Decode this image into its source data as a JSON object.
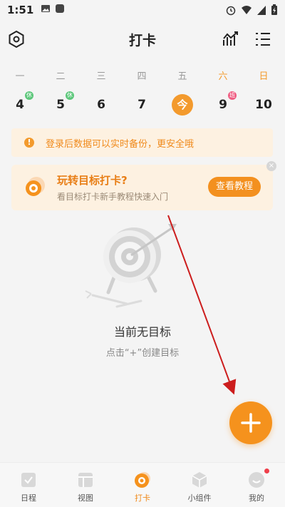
{
  "status_bar": {
    "time": "1:51",
    "icons": [
      "image-icon",
      "app-icon",
      "alarm-icon",
      "wifi-icon",
      "signal-icon",
      "battery-icon"
    ]
  },
  "header": {
    "title": "打卡",
    "left_icon": "settings-hexagon-icon",
    "right_icons": [
      "stats-chart-icon",
      "list-menu-icon"
    ]
  },
  "week": {
    "days": [
      "一",
      "二",
      "三",
      "四",
      "五",
      "六",
      "日"
    ],
    "dates": [
      {
        "label": "4",
        "badge": "休"
      },
      {
        "label": "5",
        "badge": "休"
      },
      {
        "label": "6",
        "badge": ""
      },
      {
        "label": "7",
        "badge": ""
      },
      {
        "label": "今",
        "badge": ""
      },
      {
        "label": "9",
        "badge": "班"
      },
      {
        "label": "10",
        "badge": ""
      }
    ]
  },
  "notice": {
    "text": "登录后数据可以实时备份，更安全哦",
    "icon": "exclamation-icon"
  },
  "promo": {
    "title": "玩转目标打卡?",
    "subtitle": "看目标打卡新手教程快速入门",
    "button": "查看教程",
    "close": "×"
  },
  "empty_state": {
    "title": "当前无目标",
    "subtitle": "点击“+”创建目标",
    "illustration": "target-dart-icon"
  },
  "fab": {
    "icon": "plus-icon"
  },
  "tabs": [
    {
      "label": "日程",
      "icon": "schedule-check-icon",
      "active": false
    },
    {
      "label": "视图",
      "icon": "grid-view-icon",
      "active": false
    },
    {
      "label": "打卡",
      "icon": "target-icon",
      "active": true
    },
    {
      "label": "小组件",
      "icon": "cube-icon",
      "active": false
    },
    {
      "label": "我的",
      "icon": "profile-smile-icon",
      "active": false
    }
  ],
  "colors": {
    "accent": "#f5921d",
    "notice_bg": "#fdf1e1",
    "rest_badge": "#5cc77a",
    "work_badge": "#ef5d82",
    "annotation_arrow": "#cc1d1d"
  }
}
